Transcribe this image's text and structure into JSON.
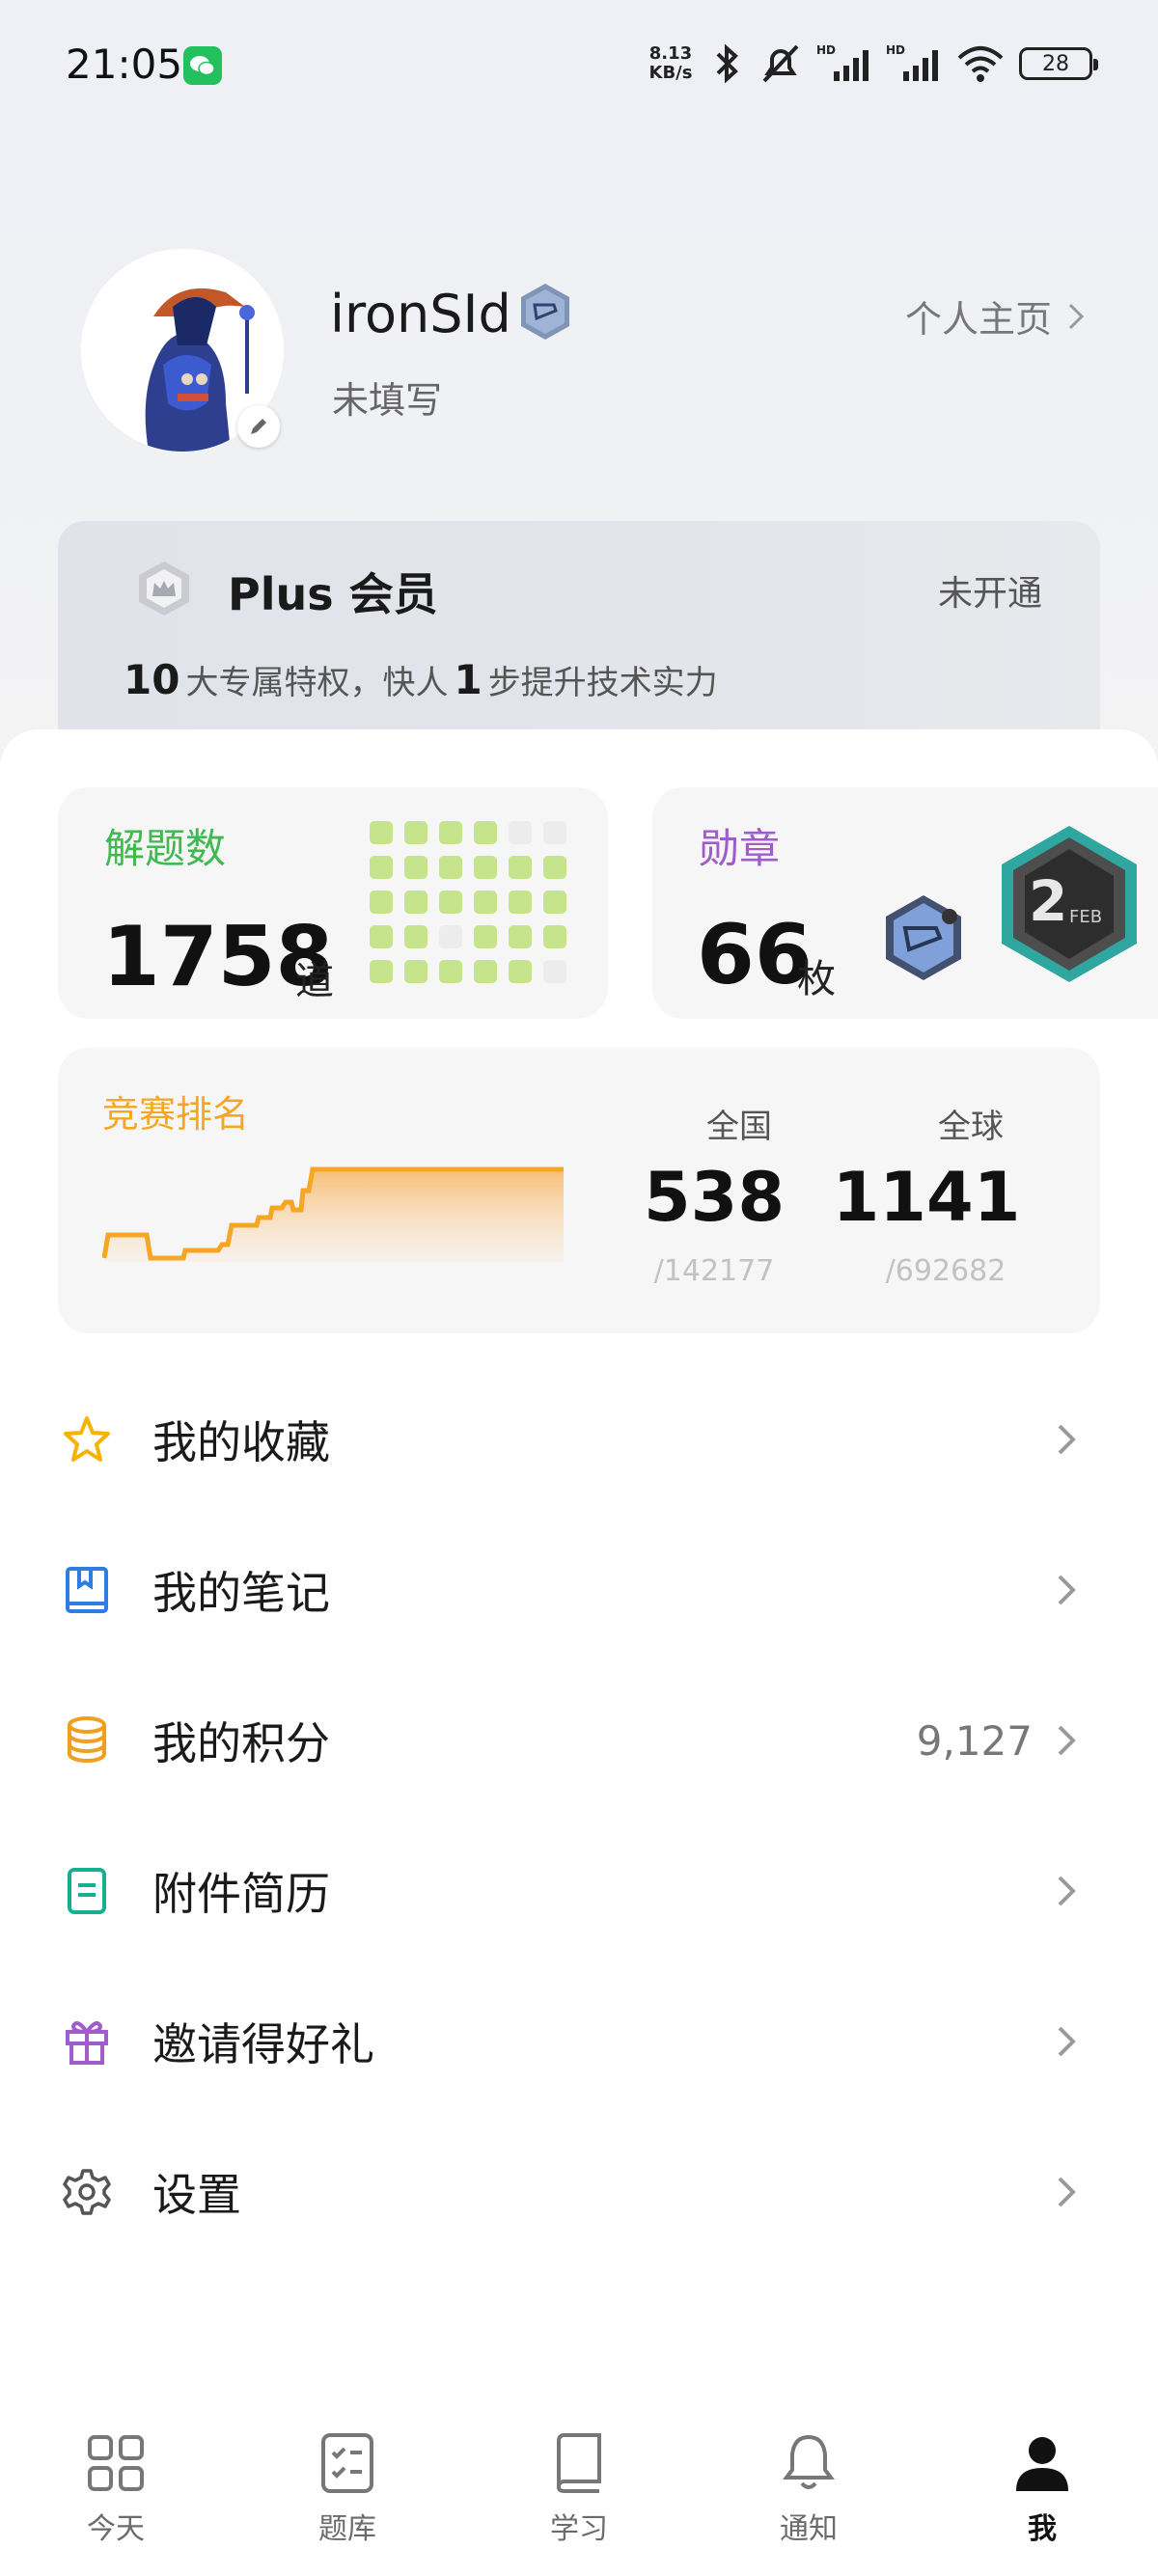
{
  "status_bar": {
    "time": "21:05",
    "net_speed_value": "8.13",
    "net_speed_unit": "KB/s",
    "battery": "28"
  },
  "profile": {
    "username": "ironSId",
    "subtitle": "未填写",
    "homepage_link": "个人主页"
  },
  "plus": {
    "title": "Plus 会员",
    "status": "未开通",
    "desc_num1": "10",
    "desc_part1": "大专属特权，快人",
    "desc_num2": "1",
    "desc_part2": "步提升技术实力"
  },
  "solved": {
    "label": "解题数",
    "count": "1758",
    "unit": "道",
    "label_color": "#3fb950",
    "grid_colors": [
      "#c6e48b",
      "#ececec"
    ]
  },
  "badges": {
    "label": "勋章",
    "count": "66",
    "unit": "枚",
    "label_color": "#a05bcc",
    "feb_badge_number": "2",
    "feb_badge_text": "FEB"
  },
  "contest": {
    "label": "竞赛排名",
    "label_color": "#f5a623",
    "national_label": "全国",
    "national_rank": "538",
    "national_total": "/142177",
    "global_label": "全球",
    "global_rank": "1141",
    "global_total": "/692682"
  },
  "menu": [
    {
      "label": "我的收藏",
      "icon": "star-icon",
      "value": ""
    },
    {
      "label": "我的笔记",
      "icon": "notebook-icon",
      "value": ""
    },
    {
      "label": "我的积分",
      "icon": "coins-icon",
      "value": "9,127"
    },
    {
      "label": "附件简历",
      "icon": "resume-icon",
      "value": ""
    },
    {
      "label": "邀请得好礼",
      "icon": "gift-icon",
      "value": ""
    },
    {
      "label": "设置",
      "icon": "gear-icon",
      "value": ""
    }
  ],
  "tabs": [
    {
      "label": "今天",
      "icon": "grid-icon",
      "active": false
    },
    {
      "label": "题库",
      "icon": "checklist-icon",
      "active": false
    },
    {
      "label": "学习",
      "icon": "book-icon",
      "active": false
    },
    {
      "label": "通知",
      "icon": "bell-icon",
      "active": false
    },
    {
      "label": "我",
      "icon": "user-icon",
      "active": true
    }
  ]
}
